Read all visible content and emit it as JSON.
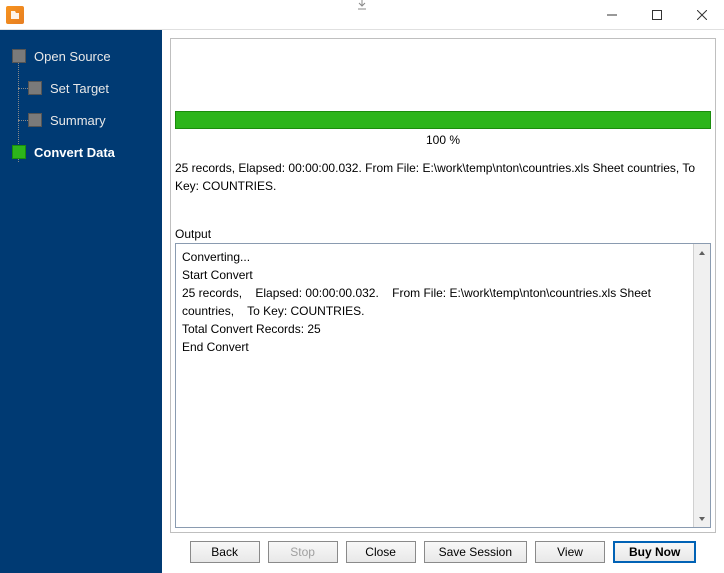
{
  "sidebar": {
    "items": [
      {
        "label": "Open Source"
      },
      {
        "label": "Set Target"
      },
      {
        "label": "Summary"
      },
      {
        "label": "Convert Data"
      }
    ]
  },
  "progress": {
    "percent_text": "100 %"
  },
  "status": {
    "text": "25 records,    Elapsed: 00:00:00.032.    From File: E:\\work\\temp\\nton\\countries.xls Sheet countries,    To Key: COUNTRIES."
  },
  "output": {
    "label": "Output",
    "lines": "Converting...\nStart Convert\n25 records,    Elapsed: 00:00:00.032.    From File: E:\\work\\temp\\nton\\countries.xls Sheet countries,    To Key: COUNTRIES.\nTotal Convert Records: 25\nEnd Convert"
  },
  "buttons": {
    "back": "Back",
    "stop": "Stop",
    "close": "Close",
    "save_session": "Save Session",
    "view": "View",
    "buy_now": "Buy Now"
  }
}
